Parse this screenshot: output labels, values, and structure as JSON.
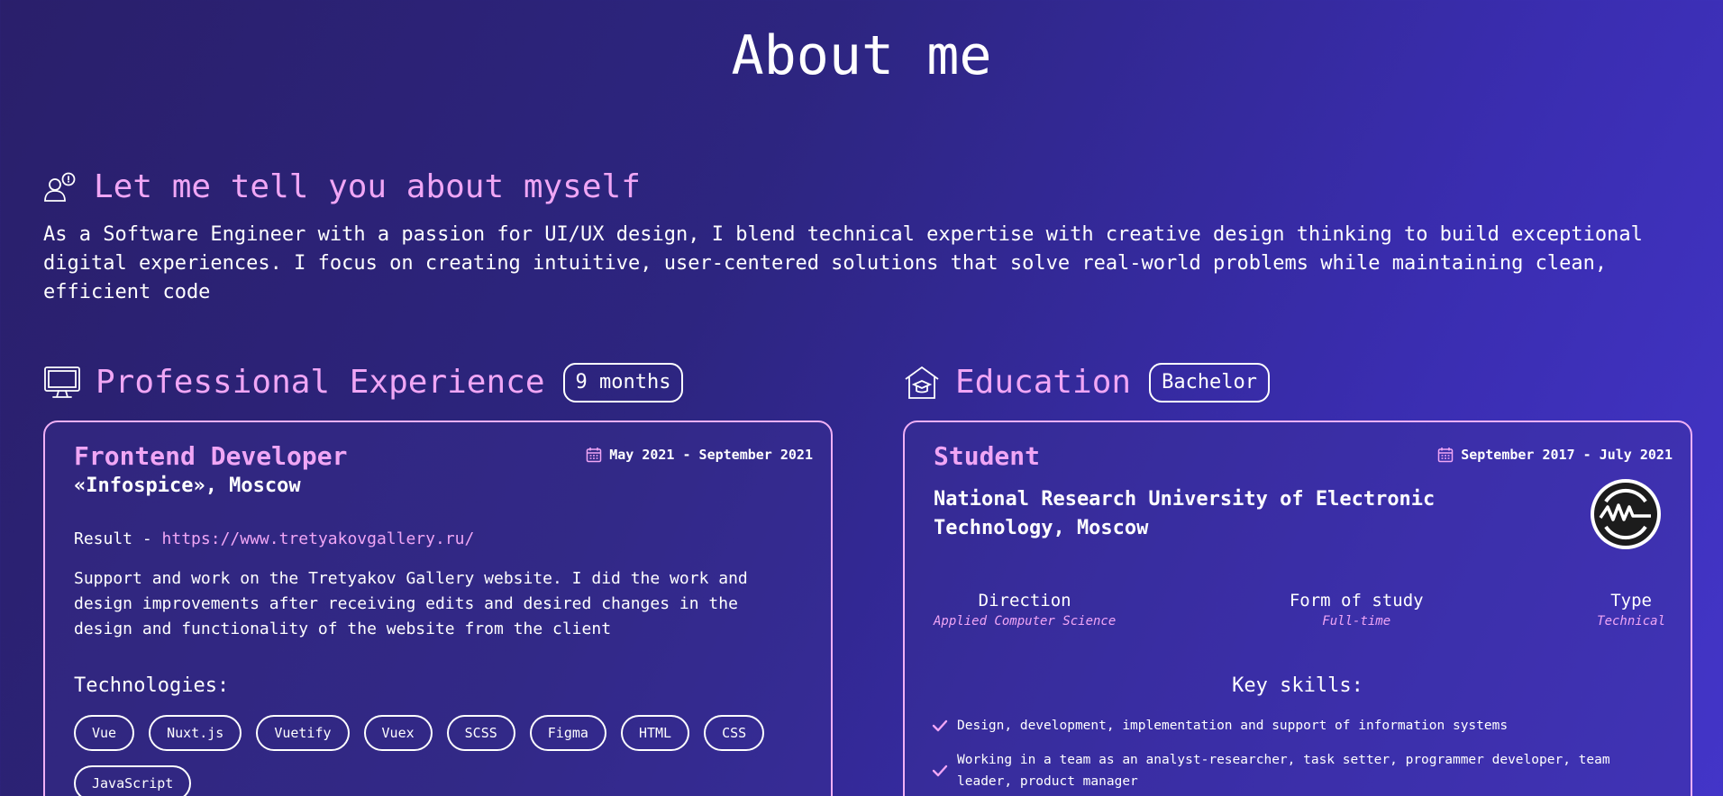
{
  "page": {
    "title": "About me"
  },
  "about": {
    "heading": "Let me tell you about myself",
    "text": "As a Software Engineer with a passion for UI/UX design, I blend technical expertise with creative design thinking to build exceptional digital experiences. I focus on creating intuitive, user-centered solutions that solve real-world problems while maintaining clean, efficient code"
  },
  "experience": {
    "heading": "Professional Experience",
    "badge": "9 months",
    "role": "Frontend Developer",
    "date": "May 2021 - September 2021",
    "company": "«Infospice», Moscow",
    "result_label": "Result - ",
    "result_link": "https://www.tretyakovgallery.ru/",
    "description": "Support and work on the Tretyakov Gallery website. I did the work and design improvements after receiving edits and desired changes in the design and functionality of the website from the client",
    "technologies_title": "Technologies:",
    "technologies": [
      "Vue",
      "Nuxt.js",
      "Vuetify",
      "Vuex",
      "SCSS",
      "Figma",
      "HTML",
      "CSS",
      "JavaScript"
    ]
  },
  "education": {
    "heading": "Education",
    "badge": "Bachelor",
    "role": "Student",
    "date": "September 2017 - July 2021",
    "university": "National Research University of Electronic Technology, Moscow",
    "facts": [
      {
        "label": "Direction",
        "value": "Applied Computer Science"
      },
      {
        "label": "Form of study",
        "value": "Full-time"
      },
      {
        "label": "Type",
        "value": "Technical"
      }
    ],
    "skills_title": "Key skills:",
    "skills": [
      "Design, development, implementation and support of information systems",
      "Working in a team as an analyst-researcher, task setter, programmer developer, team leader, product manager"
    ]
  },
  "icons": {
    "about": "person-speech-icon",
    "experience": "monitor-icon",
    "education": "school-building-icon",
    "date": "calendar-icon",
    "skill": "check-icon",
    "university_logo": "university-logo-icon"
  },
  "colors": {
    "accent": "#f0a6f5",
    "text": "#ffffff",
    "background_start": "#2a1f6b",
    "background_end": "#4335c8"
  }
}
